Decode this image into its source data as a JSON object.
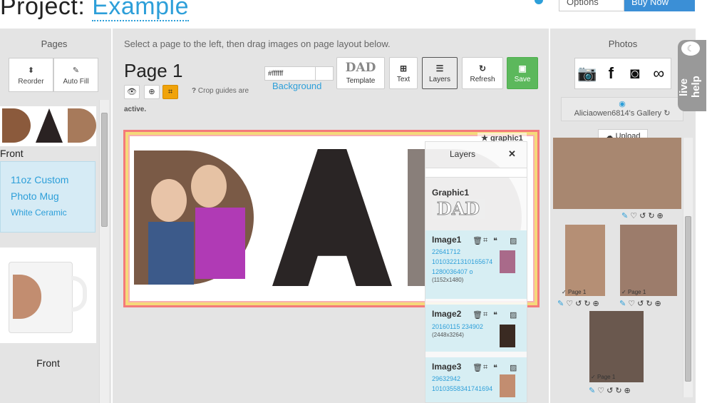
{
  "header": {
    "title_prefix": "Project:",
    "title_name": "Example",
    "options_label": "Options",
    "buy_label": "Buy Now"
  },
  "left": {
    "title": "Pages",
    "reorder_label": "Reorder",
    "autofill_label": "Auto Fill",
    "thumb1_text": "DAD",
    "thumb1_caption": "Front",
    "product_lines": [
      "11oz Custom",
      "Photo Mug",
      "White Ceramic"
    ],
    "thumb2_caption": "Front"
  },
  "center": {
    "instruction": "Select a page to the left, then drag images on page layout below.",
    "page_title": "Page 1",
    "bg_value": "#ffffff",
    "bg_label": "Background",
    "crop_text": "Crop guides are",
    "crop_status": "active.",
    "template_label": "Template",
    "template_art": "DAD",
    "text_label": "Text",
    "layers_label": "Layers",
    "refresh_label": "Refresh",
    "save_label": "Save",
    "canvas_text": "DAD",
    "graphic_badge": "graphic1"
  },
  "layers": {
    "title": "Layers",
    "graphic_name": "Graphic1",
    "graphic_art": "DAD",
    "items": [
      {
        "name": "Image1",
        "file": [
          "22641712",
          "10103221310165674",
          "1280036407 o"
        ],
        "dims": "(1152x1480)"
      },
      {
        "name": "Image2",
        "file": [
          "20160115 234902"
        ],
        "dims": "(2448x3264)"
      },
      {
        "name": "Image3",
        "file": [
          "29632942",
          "10103558341741694"
        ],
        "dims": ""
      }
    ]
  },
  "right": {
    "title": "Photos",
    "gallery": "Aliciaowen6814's Gallery",
    "upload_label": "Upload",
    "page_tag": "Page 1",
    "live_help": "live help"
  },
  "colors": {
    "accent": "#2d9fd9",
    "save": "#5cb85c",
    "panel": "#e4e4e4",
    "crop_active": "#f0a30a",
    "canvas_border": "#f47a7a"
  }
}
